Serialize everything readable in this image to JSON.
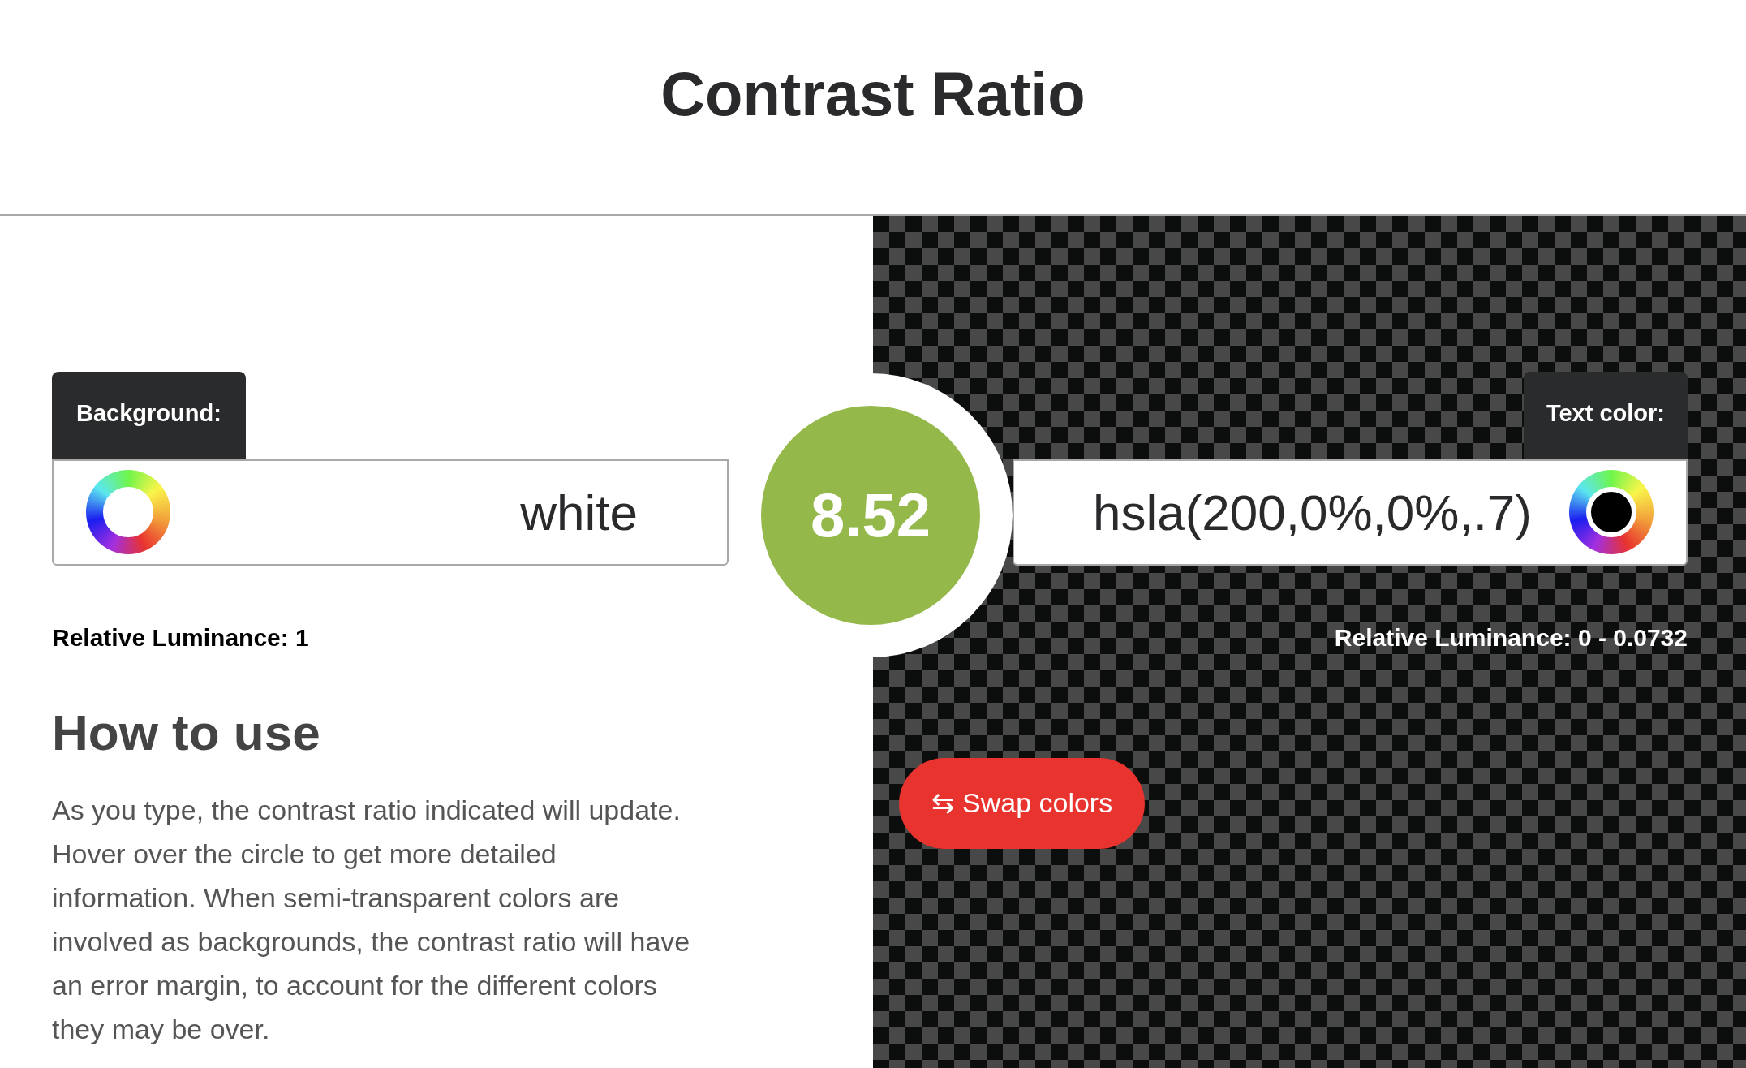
{
  "title": "Contrast Ratio",
  "background": {
    "label": "Background:",
    "value": "white",
    "luminance": "Relative Luminance: 1"
  },
  "text_color": {
    "label": "Text color:",
    "value": "hsla(200,0%,0%,.7)",
    "luminance": "Relative Luminance: 0 - 0.0732"
  },
  "ratio": "8.52",
  "how_to_use": {
    "heading": "How to use",
    "body": "As you type, the contrast ratio indicated will update. Hover over the circle to get more detailed information. When semi-transparent colors are involved as backgrounds, the contrast ratio will have an error margin, to account for the different colors they may be over."
  },
  "swap_button": {
    "icon": "⇆",
    "label": "Swap colors"
  }
}
